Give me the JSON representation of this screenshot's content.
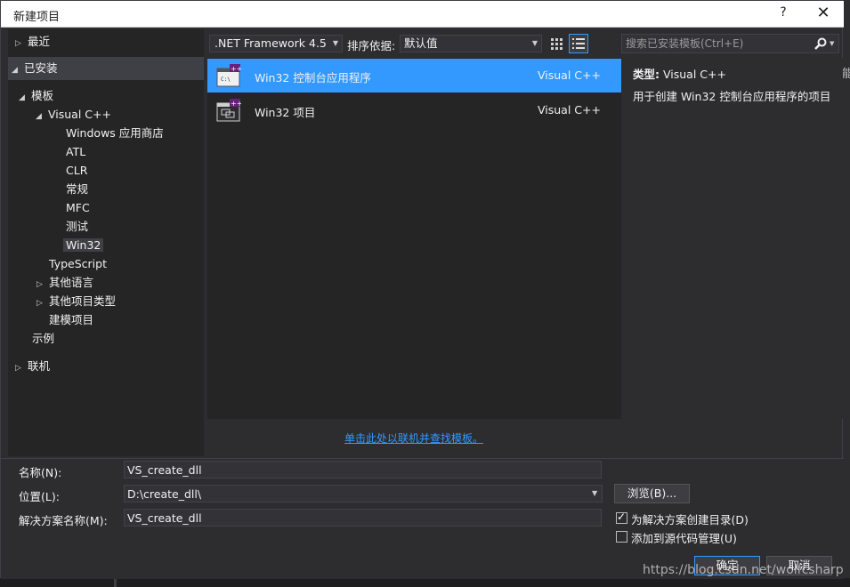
{
  "window": {
    "title": "新建项目",
    "help_label": "?",
    "close_label": "✕"
  },
  "tree": {
    "recent": "最近",
    "installed": "已安装",
    "templates": "模板",
    "visual_cpp": "Visual C++",
    "children": [
      "Windows 应用商店",
      "ATL",
      "CLR",
      "常规",
      "MFC",
      "测试",
      "Win32"
    ],
    "typescript": "TypeScript",
    "other_languages": "其他语言",
    "other_project_types": "其他项目类型",
    "modeling_projects": "建模项目",
    "samples": "示例",
    "online": "联机"
  },
  "toolbar": {
    "framework": ".NET Framework 4.5",
    "sort_label": "排序依据:",
    "sort_value": "默认值",
    "search_placeholder": "搜索已安装模板(Ctrl+E)"
  },
  "templates": [
    {
      "name": "Win32 控制台应用程序",
      "language": "Visual C++",
      "selected": true
    },
    {
      "name": "Win32 项目",
      "language": "Visual C++",
      "selected": false
    }
  ],
  "online_link": "单击此处以联机并查找模板。",
  "info": {
    "type_label": "类型:",
    "type_value": "Visual C++",
    "description": "用于创建 Win32 控制台应用程序的项目"
  },
  "form": {
    "name_label": "名称(N):",
    "name_value": "VS_create_dll",
    "location_label": "位置(L):",
    "location_value": "D:\\create_dll\\",
    "solution_label": "解决方案名称(M):",
    "solution_value": "VS_create_dll",
    "browse_label": "浏览(B)...",
    "create_dir_label": "为解决方案创建目录(D)",
    "create_dir_checked": true,
    "source_control_label": "添加到源代码管理(U)",
    "source_control_checked": false,
    "ok_label": "确定",
    "cancel_label": "取消"
  },
  "watermark": "https://blog.csdn.net/wolfcsharp",
  "colors": {
    "accent": "#3399ff",
    "background": "#2d2d30",
    "panel": "#252526"
  }
}
